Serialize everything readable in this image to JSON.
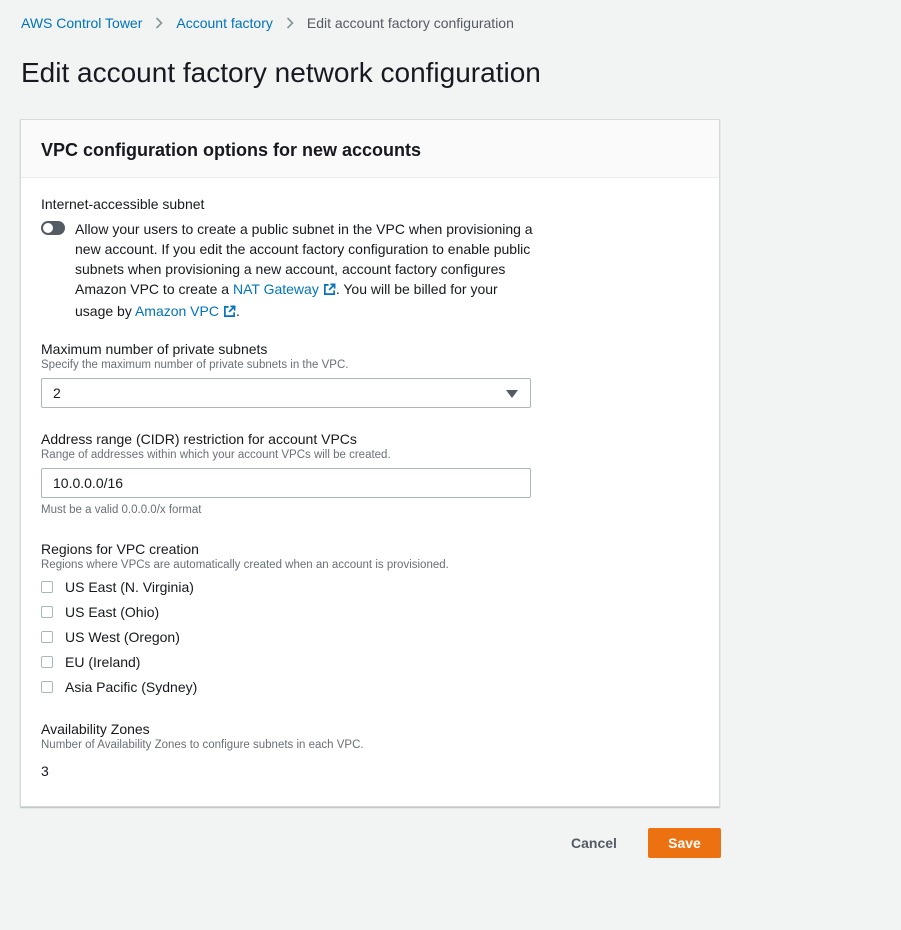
{
  "breadcrumbs": [
    {
      "label": "AWS Control Tower"
    },
    {
      "label": "Account factory"
    },
    {
      "label": "Edit account factory configuration"
    }
  ],
  "page_title": "Edit account factory network configuration",
  "panel": {
    "title": "VPC configuration options for new accounts",
    "internet_subnet": {
      "label": "Internet-accessible subnet",
      "enabled": false,
      "text_1": "Allow your users to create a public subnet in the VPC when provisioning a new account. If you edit the account factory configuration to enable public subnets when provisioning a new account, account factory configures Amazon VPC to create a ",
      "link_1": "NAT Gateway",
      "text_2": ". You will be billed for your usage by ",
      "link_2": "Amazon VPC",
      "text_3": "."
    },
    "private_subnets": {
      "label": "Maximum number of private subnets",
      "description": "Specify the maximum number of private subnets in the VPC.",
      "value": "2"
    },
    "cidr": {
      "label": "Address range (CIDR) restriction for account VPCs",
      "description": "Range of addresses within which your account VPCs will be created.",
      "value": "10.0.0.0/16",
      "constraint": "Must be a valid 0.0.0.0/x format"
    },
    "regions": {
      "label": "Regions for VPC creation",
      "description": "Regions where VPCs are automatically created when an account is provisioned.",
      "options": [
        {
          "label": "US East (N. Virginia)",
          "checked": false
        },
        {
          "label": "US East (Ohio)",
          "checked": false
        },
        {
          "label": "US West (Oregon)",
          "checked": false
        },
        {
          "label": "EU (Ireland)",
          "checked": false
        },
        {
          "label": "Asia Pacific (Sydney)",
          "checked": false
        }
      ]
    },
    "azs": {
      "label": "Availability Zones",
      "description": "Number of Availability Zones to configure subnets in each VPC.",
      "value": "3"
    }
  },
  "actions": {
    "cancel_label": "Cancel",
    "save_label": "Save"
  },
  "icons": {
    "breadcrumb_separator": "chevron-right-icon",
    "external_link": "external-link-icon",
    "dropdown": "caret-down-icon"
  },
  "colors": {
    "link": "#0073bb",
    "primary_button": "#ec7211",
    "toggle_off": "#545b64",
    "background": "#f2f3f3"
  }
}
